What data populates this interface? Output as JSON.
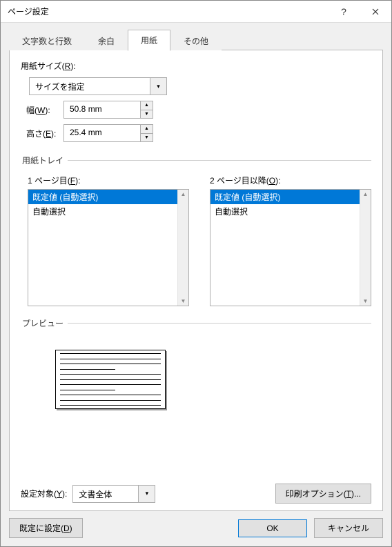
{
  "title": "ページ設定",
  "tabs": {
    "t0": "文字数と行数",
    "t1": "余白",
    "t2": "用紙",
    "t3": "その他"
  },
  "paper": {
    "size_label_pre": "用紙サイズ(",
    "size_label_u": "R",
    "size_label_post": "):",
    "size_value": "サイズを指定",
    "width_label_pre": "幅(",
    "width_label_u": "W",
    "width_label_post": "):",
    "width_value": "50.8 mm",
    "height_label_pre": "高さ(",
    "height_label_u": "E",
    "height_label_post": "):",
    "height_value": "25.4 mm"
  },
  "tray": {
    "legend": "用紙トレイ",
    "first_label_pre": "1 ページ目(",
    "first_label_u": "F",
    "first_label_post": "):",
    "other_label_pre": "2 ページ目以降(",
    "other_label_u": "O",
    "other_label_post": "):",
    "item_default": "既定値 (自動選択)",
    "item_auto": "自動選択"
  },
  "preview_legend": "プレビュー",
  "apply": {
    "label_pre": "設定対象(",
    "label_u": "Y",
    "label_post": "):",
    "value": "文書全体"
  },
  "buttons": {
    "print_options_pre": "印刷オプション(",
    "print_options_u": "T",
    "print_options_post": ")...",
    "set_default_pre": "既定に設定(",
    "set_default_u": "D",
    "set_default_post": ")",
    "ok": "OK",
    "cancel": "キャンセル"
  }
}
